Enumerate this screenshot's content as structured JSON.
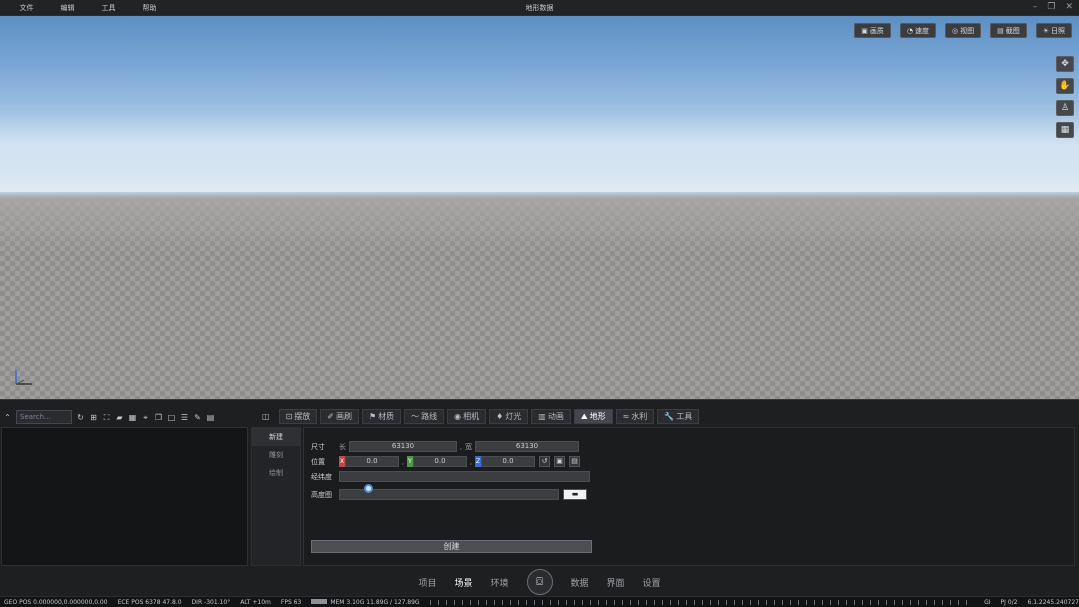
{
  "titlebar": {
    "menus": [
      "文件",
      "编辑",
      "工具",
      "帮助"
    ],
    "title": "地形数据"
  },
  "viewport": {
    "top_buttons": [
      "画质",
      "速度",
      "视图",
      "截图",
      "日照"
    ],
    "side_tools": [
      "move-icon",
      "pan-icon",
      "person-icon",
      "map-icon"
    ]
  },
  "left_panel": {
    "search_placeholder": "Search..."
  },
  "tabs": [
    {
      "label": "摆放",
      "icon": "cube-icon"
    },
    {
      "label": "画刷",
      "icon": "brush-icon"
    },
    {
      "label": "材质",
      "icon": "material-icon"
    },
    {
      "label": "路线",
      "icon": "route-icon"
    },
    {
      "label": "相机",
      "icon": "camera-icon"
    },
    {
      "label": "灯光",
      "icon": "light-icon"
    },
    {
      "label": "动画",
      "icon": "film-icon"
    },
    {
      "label": "地形",
      "icon": "terrain-icon"
    },
    {
      "label": "水利",
      "icon": "water-icon"
    },
    {
      "label": "工具",
      "icon": "wrench-icon"
    }
  ],
  "active_tab": "地形",
  "subnav": [
    "新建",
    "雕刻",
    "绘制"
  ],
  "form": {
    "size_label": "尺寸",
    "length_label": "长",
    "length_value": "63130",
    "width_label": "宽",
    "width_value": "63130",
    "position_label": "位置",
    "x_label": "X",
    "x_value": "0.0",
    "y_label": "Y",
    "y_value": "0.0",
    "z_label": "Z",
    "z_value": "0.0",
    "row3_label": "经纬度",
    "row4_label": "高度图",
    "create_label": "创建"
  },
  "bottom_nav": {
    "items_left": [
      "项目",
      "场景",
      "环境"
    ],
    "items_right": [
      "数据",
      "界面",
      "设置"
    ],
    "active": "场景",
    "logo": "⌼"
  },
  "status": {
    "geo": "GEO POS  0.000000,0.000000,0.00",
    "ece": "ECE POS  6378 47.8.0",
    "dir": "DIR  -301.10°",
    "alt": "ALT  +10m",
    "fps": "FPS  63",
    "mem": "MEM  3.10G  11.89G / 127.89G",
    "gi": "GI",
    "pj": "PJ  0/2",
    "ver": "6.1.2245.240727"
  },
  "colors": {
    "accent": "#4a8fe0",
    "panel_bg": "#1e1f21"
  }
}
